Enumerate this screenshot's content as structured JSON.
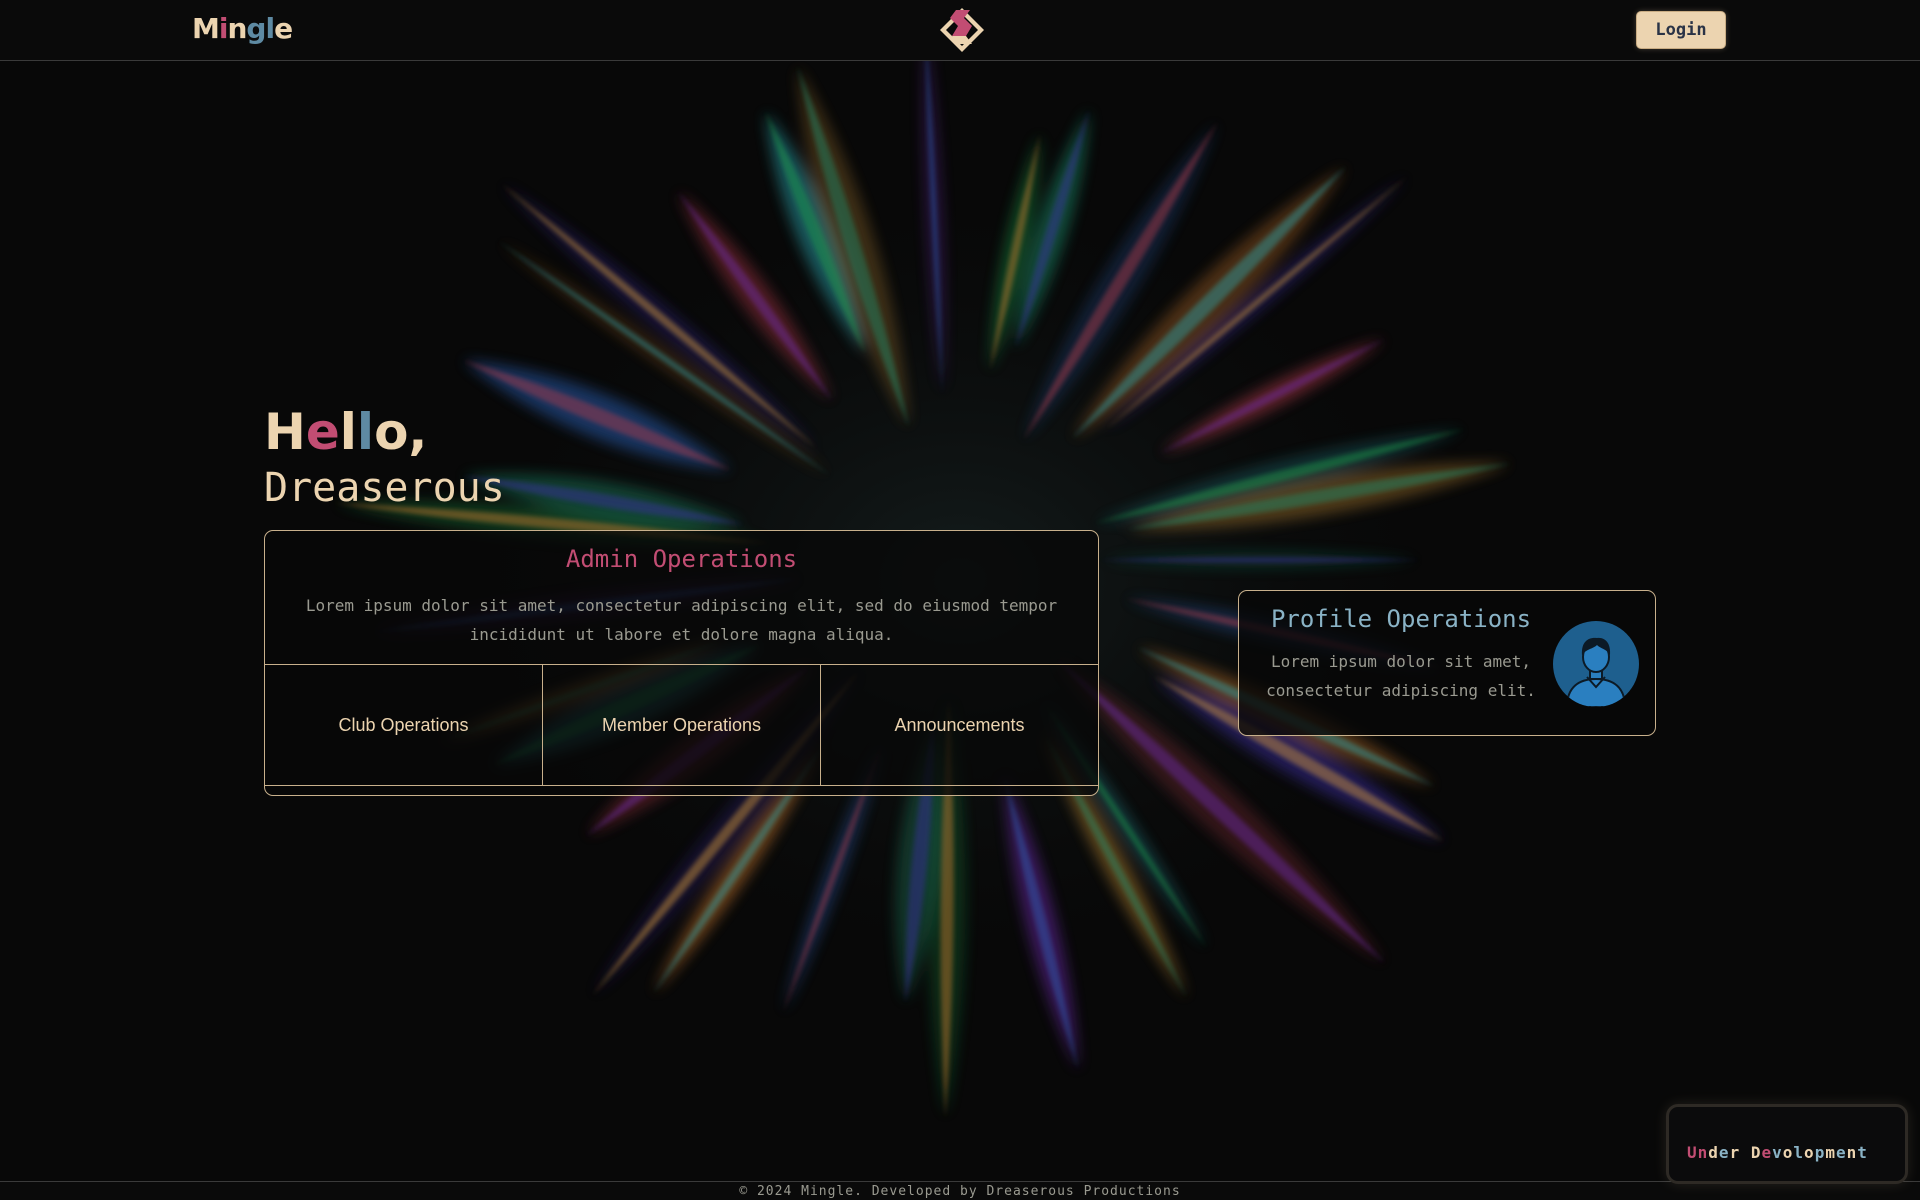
{
  "header": {
    "logo": [
      "M",
      "i",
      "n",
      "g",
      "l",
      "e"
    ],
    "logo_colors": [
      "#ecd4b0",
      "#c24d73",
      "#ecd4b0",
      "#5e8aa3",
      "#5e8aa3",
      "#ecd4b0"
    ],
    "login_label": "Login"
  },
  "greeting": {
    "hello": [
      "H",
      "e",
      "l",
      "l",
      "o",
      ","
    ],
    "hello_colors": [
      "#ecd4b0",
      "#c24d73",
      "#ecd4b0",
      "#5e8aa3",
      "#ecd4b0",
      "#ecd4b0"
    ],
    "name": "Dreaserous"
  },
  "admin": {
    "title": "Admin Operations",
    "description": "Lorem ipsum dolor sit amet, consectetur adipiscing elit, sed do eiusmod tempor incididunt ut labore et dolore magna aliqua.",
    "operations": [
      {
        "label": "Club Operations"
      },
      {
        "label": "Member Operations"
      },
      {
        "label": "Announcements"
      }
    ]
  },
  "profile": {
    "title": "Profile Operations",
    "description": "Lorem ipsum dolor sit amet, consectetur adipiscing elit.",
    "avatar_icon": "user-avatar-icon"
  },
  "badge": {
    "letters": [
      "U",
      "n",
      "d",
      "e",
      "r",
      " ",
      "D",
      "e",
      "v",
      "o",
      "l",
      "o",
      "p",
      "m",
      "e",
      "n",
      "t"
    ],
    "letter_colors": [
      "#c24d73",
      "#c24d73",
      "#ecd4b0",
      "#8ab3c6",
      "#ecd4b0",
      "#ecd4b0",
      "#ecd4b0",
      "#c24d73",
      "#8ab3c6",
      "#ecd4b0",
      "#8ab3c6",
      "#ecd4b0",
      "#8ab3c6",
      "#ecd4b0",
      "#8ab3c6",
      "#ecd4b0",
      "#8ab3c6"
    ]
  },
  "footer": {
    "text": "© 2024 Mingle. Developed by Dreaserous Productions"
  },
  "colors": {
    "accent_pink": "#c24d73",
    "accent_cream": "#ecd4b0",
    "accent_blue": "#5e8aa3",
    "background": "#080808"
  }
}
